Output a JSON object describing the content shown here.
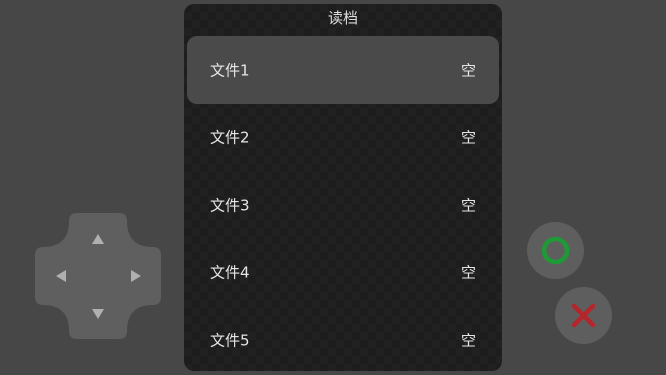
{
  "dialog": {
    "title": "读档",
    "slots": [
      {
        "name": "文件1",
        "state": "空",
        "selected": true
      },
      {
        "name": "文件2",
        "state": "空",
        "selected": false
      },
      {
        "name": "文件3",
        "state": "空",
        "selected": false
      },
      {
        "name": "文件4",
        "state": "空",
        "selected": false
      },
      {
        "name": "文件5",
        "state": "空",
        "selected": false
      }
    ]
  },
  "dpad": {
    "up_icon": "triangle-up-icon",
    "down_icon": "triangle-down-icon",
    "left_icon": "triangle-left-icon",
    "right_icon": "triangle-right-icon"
  },
  "buttons": {
    "confirm_icon": "circle-icon",
    "cancel_icon": "x-icon"
  },
  "colors": {
    "background": "#474747",
    "dialog": "#1d1d1d",
    "selected_row": "#4a4a4a",
    "button": "#5e5e5e",
    "confirm_green": "#1f9a36",
    "cancel_red": "#b3262c"
  }
}
